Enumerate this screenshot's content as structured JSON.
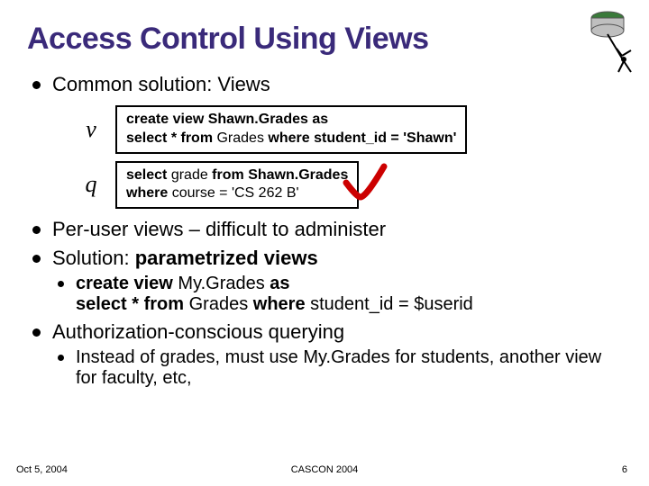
{
  "title": "Access Control Using Views",
  "bullets": {
    "b1": "Common solution: Views",
    "b2": "Per-user views – difficult to administer",
    "b3_pre": "Solution: ",
    "b3_bold": "parametrized views",
    "b4": "Authorization-conscious querying"
  },
  "vq": {
    "v_label": "v",
    "q_label": "q",
    "v_line1_a": "create view ",
    "v_line1_b": "Shawn.Grades",
    "v_line1_c": " as",
    "v_line2_a": "select * from ",
    "v_line2_b": "Grades",
    "v_line2_c": " where ",
    "v_line2_d": "student_id = 'Shawn'",
    "q_line1_a": "select  ",
    "q_line1_b": "grade",
    "q_line1_c": " from ",
    "q_line1_d": "Shawn.Grades",
    "q_line2_a": "where ",
    "q_line2_b": "course = 'CS 262 B'"
  },
  "sub": {
    "s1_a": "create view ",
    "s1_b": "My.Grades",
    "s1_c": " as",
    "s1_l2_a": "select * from ",
    "s1_l2_b": "Grades",
    "s1_l2_c": " where ",
    "s1_l2_d": "student_id = $userid",
    "s2": "Instead of grades, must use My.Grades for students, another view for faculty, etc,"
  },
  "footer": {
    "date": "Oct 5, 2004",
    "center": "CASCON 2004",
    "page": "6"
  }
}
